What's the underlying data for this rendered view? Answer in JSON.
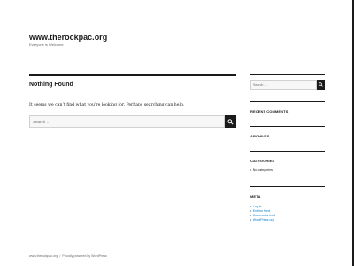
{
  "site": {
    "title": "www.therockpac.org",
    "description": "Everyone is Welcome"
  },
  "main": {
    "page_title": "Nothing Found",
    "message": "It seems we can’t find what you’re looking for. Perhaps searching can help.",
    "search": {
      "placeholder": "Search …"
    }
  },
  "sidebar": {
    "search": {
      "placeholder": "Search …"
    },
    "recent_comments_title": "RECENT COMMENTS",
    "archives_title": "ARCHIVES",
    "categories_title": "CATEGORIES",
    "categories": [
      "No categories"
    ],
    "meta_title": "META",
    "meta_links": [
      "Log in",
      "Entries feed",
      "Comments feed",
      "WordPress.org"
    ]
  },
  "footer": {
    "site_link": "www.therockpac.org",
    "separator": "/",
    "powered_by": "Proudly powered by WordPress"
  },
  "colors": {
    "link": "#007acc",
    "text": "#1a1a1a",
    "muted": "#686868"
  },
  "icons": {
    "search": "search-icon"
  }
}
